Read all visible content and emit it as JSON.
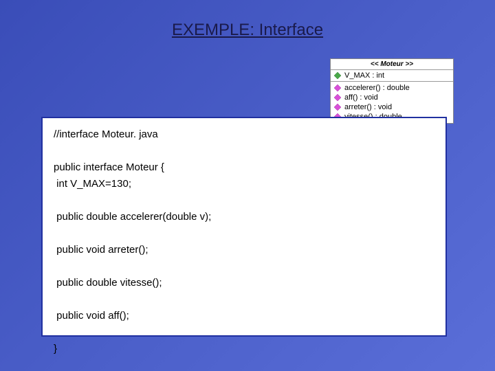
{
  "title": "EXEMPLE: Interface",
  "code": "//interface Moteur. java\n\npublic interface Moteur {\n int V_MAX=130;\n\n public double accelerer(double v);\n\n public void arreter();\n\n public double vitesse();\n\n public void aff();\n\n}",
  "uml": {
    "stereotype": "<< Moteur >>",
    "attribute": "V_MAX : int",
    "operations": [
      "accelerer() : double",
      "aff() : void",
      "arreter() : void",
      "vitesse() : double"
    ]
  }
}
